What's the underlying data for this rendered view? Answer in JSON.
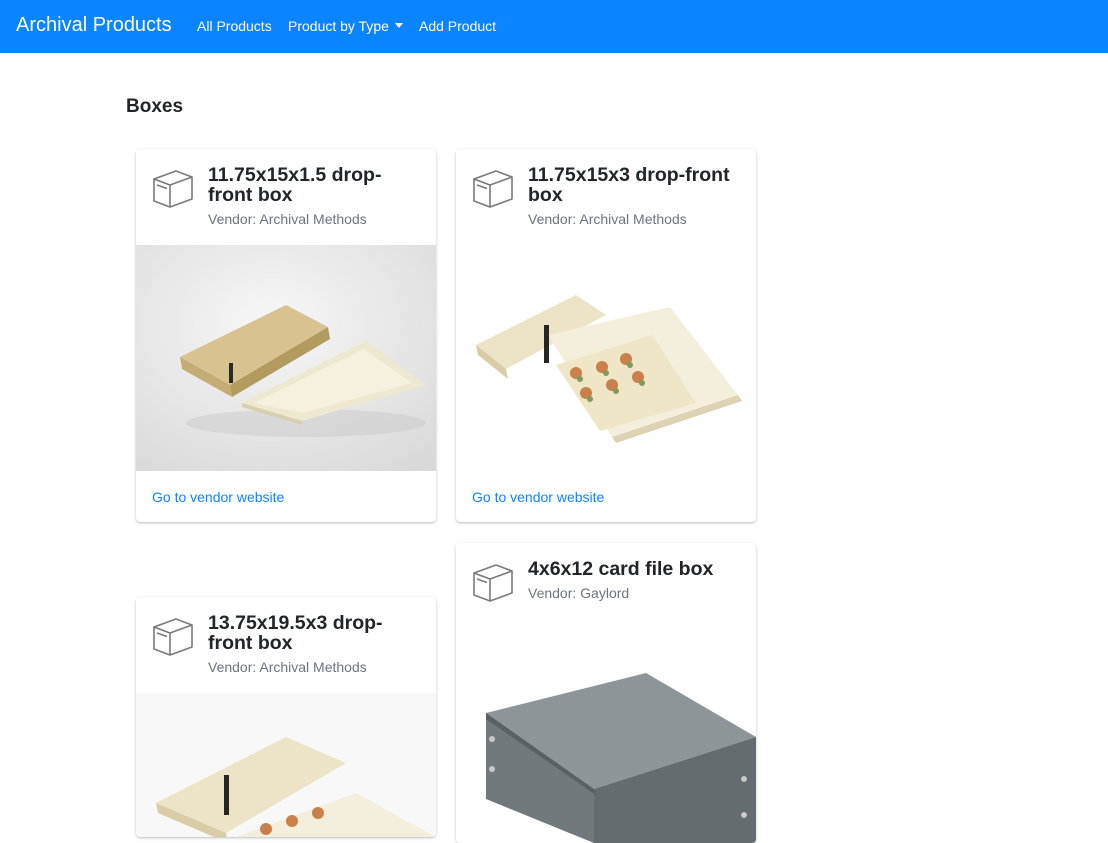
{
  "navbar": {
    "brand": "Archival Products",
    "links": [
      "All Products",
      "Product by Type",
      "Add Product"
    ]
  },
  "page": {
    "title": "Boxes"
  },
  "products": [
    {
      "title": "11.75x15x1.5 drop-front box",
      "vendor": "Vendor: Archival Methods",
      "link": "Go to vendor website",
      "icon": "box-icon"
    },
    {
      "title": "11.75x15x3 drop-front box",
      "vendor": "Vendor: Archival Methods",
      "link": "Go to vendor website",
      "icon": "box-icon"
    },
    {
      "title": "13.75x19.5x3 drop-front box",
      "vendor": "Vendor: Archival Methods",
      "icon": "box-icon"
    },
    {
      "title": "4x6x12 card file box",
      "vendor": "Vendor: Gaylord",
      "icon": "box-icon"
    }
  ],
  "colors": {
    "navbar": "#0a84ff",
    "link": "#0a84ff",
    "muted": "#6c757d"
  }
}
